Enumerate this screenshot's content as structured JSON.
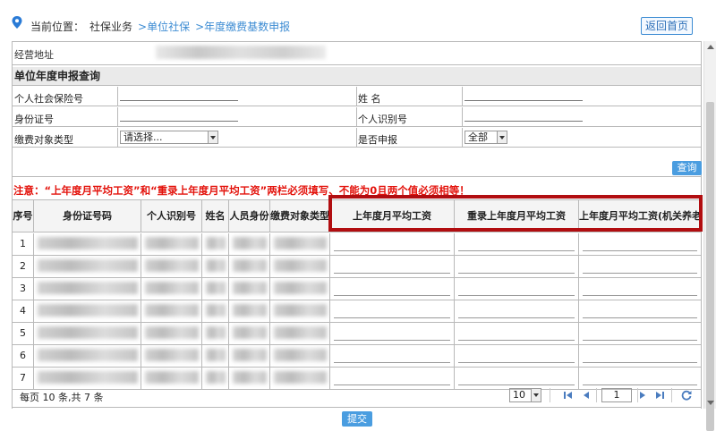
{
  "breadcrumb": {
    "prefix": "当前位置",
    "colon": "：",
    "root": "社保业务",
    "link1": ">单位社保",
    "link2": ">年度缴费基数申报"
  },
  "header": {
    "back_label": "返回首页"
  },
  "business_address_label": "经营地址",
  "section_title": "单位年度申报查询",
  "form": {
    "ssn_label": "个人社会保险号",
    "name_label": "姓 名",
    "id_label": "身份证号",
    "personal_code_label": "个人识别号",
    "payer_type_label": "缴费对象类型",
    "payer_type_value": "请选择...",
    "declared_label": "是否申报",
    "declared_value": "全部"
  },
  "query_label": "查询",
  "notice": "注意：“上年度月平均工资”和“重录上年度月平均工资”两栏必须填写、不能为0且两个值必须相等！",
  "columns": [
    "序号",
    "身份证号码",
    "个人识别号",
    "姓名",
    "人员身份",
    "缴费对象类型",
    "上年度月平均工资",
    "重录上年度月平均工资",
    "上年度月平均工资(机关养老)"
  ],
  "rows": [
    "1",
    "2",
    "3",
    "4",
    "5",
    "6",
    "7"
  ],
  "pager": {
    "info": "每页 10 条,共 7 条",
    "page_size": "10",
    "current_page": "1"
  },
  "submit_label": "提交",
  "colors": {
    "accent": "#3d8cd3",
    "highlight": "#b10d10",
    "notice": "#e3120b"
  }
}
